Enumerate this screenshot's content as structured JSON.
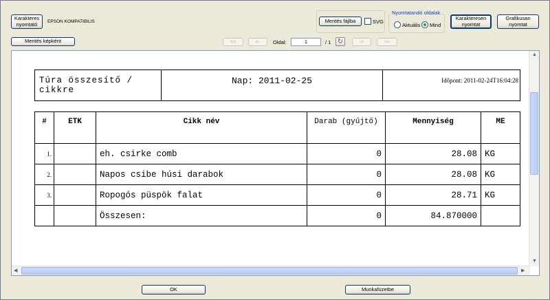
{
  "toolbar": {
    "char_printer_btn": "Karakteres nyomtató",
    "printer_name": "EPSON KOMPATIBILIS",
    "save_file_btn": "Mentés fájlba",
    "svg_label": "SVG",
    "pages_group_title": "Nyomtatandó oldalak",
    "radio_current": "Aktuális",
    "radio_all": "Mind",
    "char_print_btn": "Karakteresen nyomtat",
    "graphic_print_btn": "Grafikusan nyomtat",
    "save_image_btn": "Mentés képként"
  },
  "nav": {
    "first": "<<",
    "prev": "<-",
    "page_label": "Oldal:",
    "page_value": "1",
    "page_total": "/ 1",
    "next": "->",
    "last": ">>"
  },
  "report": {
    "title": "Túra összesítő / cikkre",
    "day": "Nap: 2011-02-25",
    "timestamp": "Időpont: 2011-02-24T16:04:28",
    "columns": [
      "#",
      "ETK",
      "Cikk név",
      "Darab (gyűjtő)",
      "Mennyiség",
      "ME"
    ],
    "rows": [
      {
        "num": "1.",
        "etk": "",
        "name": "eh. csirke comb",
        "count": "0",
        "qty": "28.08",
        "unit": "KG"
      },
      {
        "num": "2.",
        "etk": "",
        "name": "Napos csibe húsi darabok",
        "count": "0",
        "qty": "28.08",
        "unit": "KG"
      },
      {
        "num": "3.",
        "etk": "",
        "name": "Ropogós püspök falat",
        "count": "0",
        "qty": "28.71",
        "unit": "KG"
      }
    ],
    "total": {
      "label": "Összesen:",
      "count": "0",
      "qty": "84.870000"
    }
  },
  "footer": {
    "ok": "OK",
    "workbook": "Munkafüzetbe"
  }
}
